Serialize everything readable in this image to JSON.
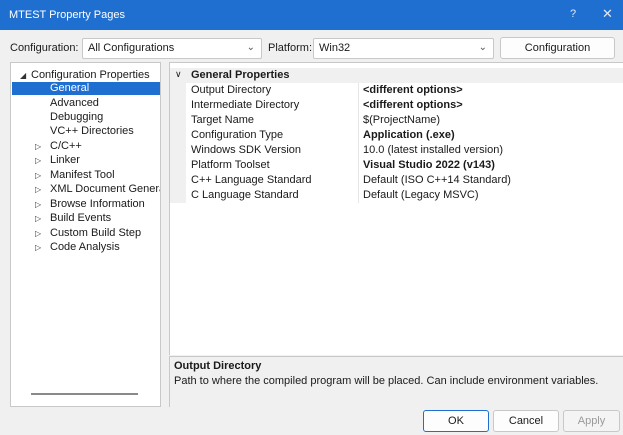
{
  "window": {
    "title": "MTEST Property Pages",
    "help_glyph": "?",
    "close_glyph": "✕"
  },
  "toolbar": {
    "configuration_label": "Configuration:",
    "configuration_value": "All Configurations",
    "platform_label": "Platform:",
    "platform_value": "Win32",
    "config_manager_label": "Configuration Manager..."
  },
  "tree": {
    "items": [
      {
        "label": "Configuration Properties",
        "expander": "◢",
        "level": 0,
        "selected": false
      },
      {
        "label": "General",
        "expander": "",
        "level": 1,
        "selected": true
      },
      {
        "label": "Advanced",
        "expander": "",
        "level": 1,
        "selected": false
      },
      {
        "label": "Debugging",
        "expander": "",
        "level": 1,
        "selected": false
      },
      {
        "label": "VC++ Directories",
        "expander": "",
        "level": 1,
        "selected": false
      },
      {
        "label": "C/C++",
        "expander": "▷",
        "level": 1,
        "selected": false
      },
      {
        "label": "Linker",
        "expander": "▷",
        "level": 1,
        "selected": false
      },
      {
        "label": "Manifest Tool",
        "expander": "▷",
        "level": 1,
        "selected": false
      },
      {
        "label": "XML Document Generator",
        "expander": "▷",
        "level": 1,
        "selected": false
      },
      {
        "label": "Browse Information",
        "expander": "▷",
        "level": 1,
        "selected": false
      },
      {
        "label": "Build Events",
        "expander": "▷",
        "level": 1,
        "selected": false
      },
      {
        "label": "Custom Build Step",
        "expander": "▷",
        "level": 1,
        "selected": false
      },
      {
        "label": "Code Analysis",
        "expander": "▷",
        "level": 1,
        "selected": false
      }
    ]
  },
  "grid": {
    "section_glyph": "∨",
    "section_title": "General Properties",
    "rows": [
      {
        "name": "Output Directory",
        "value": "<different options>",
        "bold": true
      },
      {
        "name": "Intermediate Directory",
        "value": "<different options>",
        "bold": true
      },
      {
        "name": "Target Name",
        "value": "$(ProjectName)",
        "bold": false
      },
      {
        "name": "Configuration Type",
        "value": "Application (.exe)",
        "bold": true
      },
      {
        "name": "Windows SDK Version",
        "value": "10.0 (latest installed version)",
        "bold": false
      },
      {
        "name": "Platform Toolset",
        "value": "Visual Studio 2022 (v143)",
        "bold": true
      },
      {
        "name": "C++ Language Standard",
        "value": "Default (ISO C++14 Standard)",
        "bold": false
      },
      {
        "name": "C Language Standard",
        "value": "Default (Legacy MSVC)",
        "bold": false
      }
    ]
  },
  "description": {
    "title": "Output Directory",
    "text": "Path to where the compiled program will be placed. Can include environment variables."
  },
  "buttons": {
    "ok": "OK",
    "cancel": "Cancel",
    "apply": "Apply"
  },
  "colors": {
    "accent": "#1f6fd1"
  }
}
